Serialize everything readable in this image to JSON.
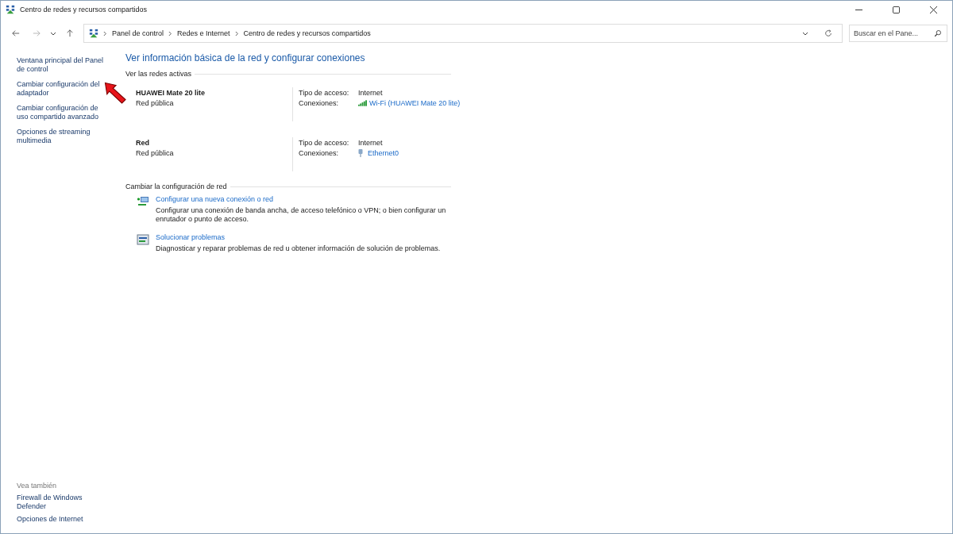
{
  "window": {
    "title": "Centro de redes y recursos compartidos"
  },
  "address_bar": {
    "breadcrumbs": [
      "Panel de control",
      "Redes e Internet",
      "Centro de redes y recursos compartidos"
    ]
  },
  "search": {
    "placeholder": "Buscar en el Pane..."
  },
  "sidebar": {
    "items": [
      {
        "label": "Ventana principal del Panel de control"
      },
      {
        "label": "Cambiar configuración del adaptador"
      },
      {
        "label": "Cambiar configuración de uso compartido avanzado"
      },
      {
        "label": "Opciones de streaming multimedia"
      }
    ],
    "see_also_title": "Vea también",
    "see_also": [
      "Firewall de Windows Defender",
      "Opciones de Internet"
    ]
  },
  "heading": "Ver información básica de la red y configurar conexiones",
  "active_networks": {
    "title": "Ver las redes activas",
    "networks": [
      {
        "name": "HUAWEI Mate 20 lite",
        "category": "Red pública",
        "access_label": "Tipo de acceso:",
        "access": "Internet",
        "connections_label": "Conexiones:",
        "connection": "Wi-Fi (HUAWEI Mate 20 lite)",
        "kind": "wifi"
      },
      {
        "name": "Red",
        "category": "Red pública",
        "access_label": "Tipo de acceso:",
        "access": "Internet",
        "connections_label": "Conexiones:",
        "connection": "Ethernet0",
        "kind": "ethernet"
      }
    ]
  },
  "change_settings": {
    "title": "Cambiar la configuración de red",
    "tasks": [
      {
        "link": "Configurar una nueva conexión o red",
        "description": "Configurar una conexión de banda ancha, de acceso telefónico o VPN; o bien configurar un enrutador o punto de acceso.",
        "kind": "new"
      },
      {
        "link": "Solucionar problemas",
        "description": "Diagnosticar y reparar problemas de red u obtener información de solución de problemas.",
        "kind": "troubleshoot"
      }
    ]
  }
}
